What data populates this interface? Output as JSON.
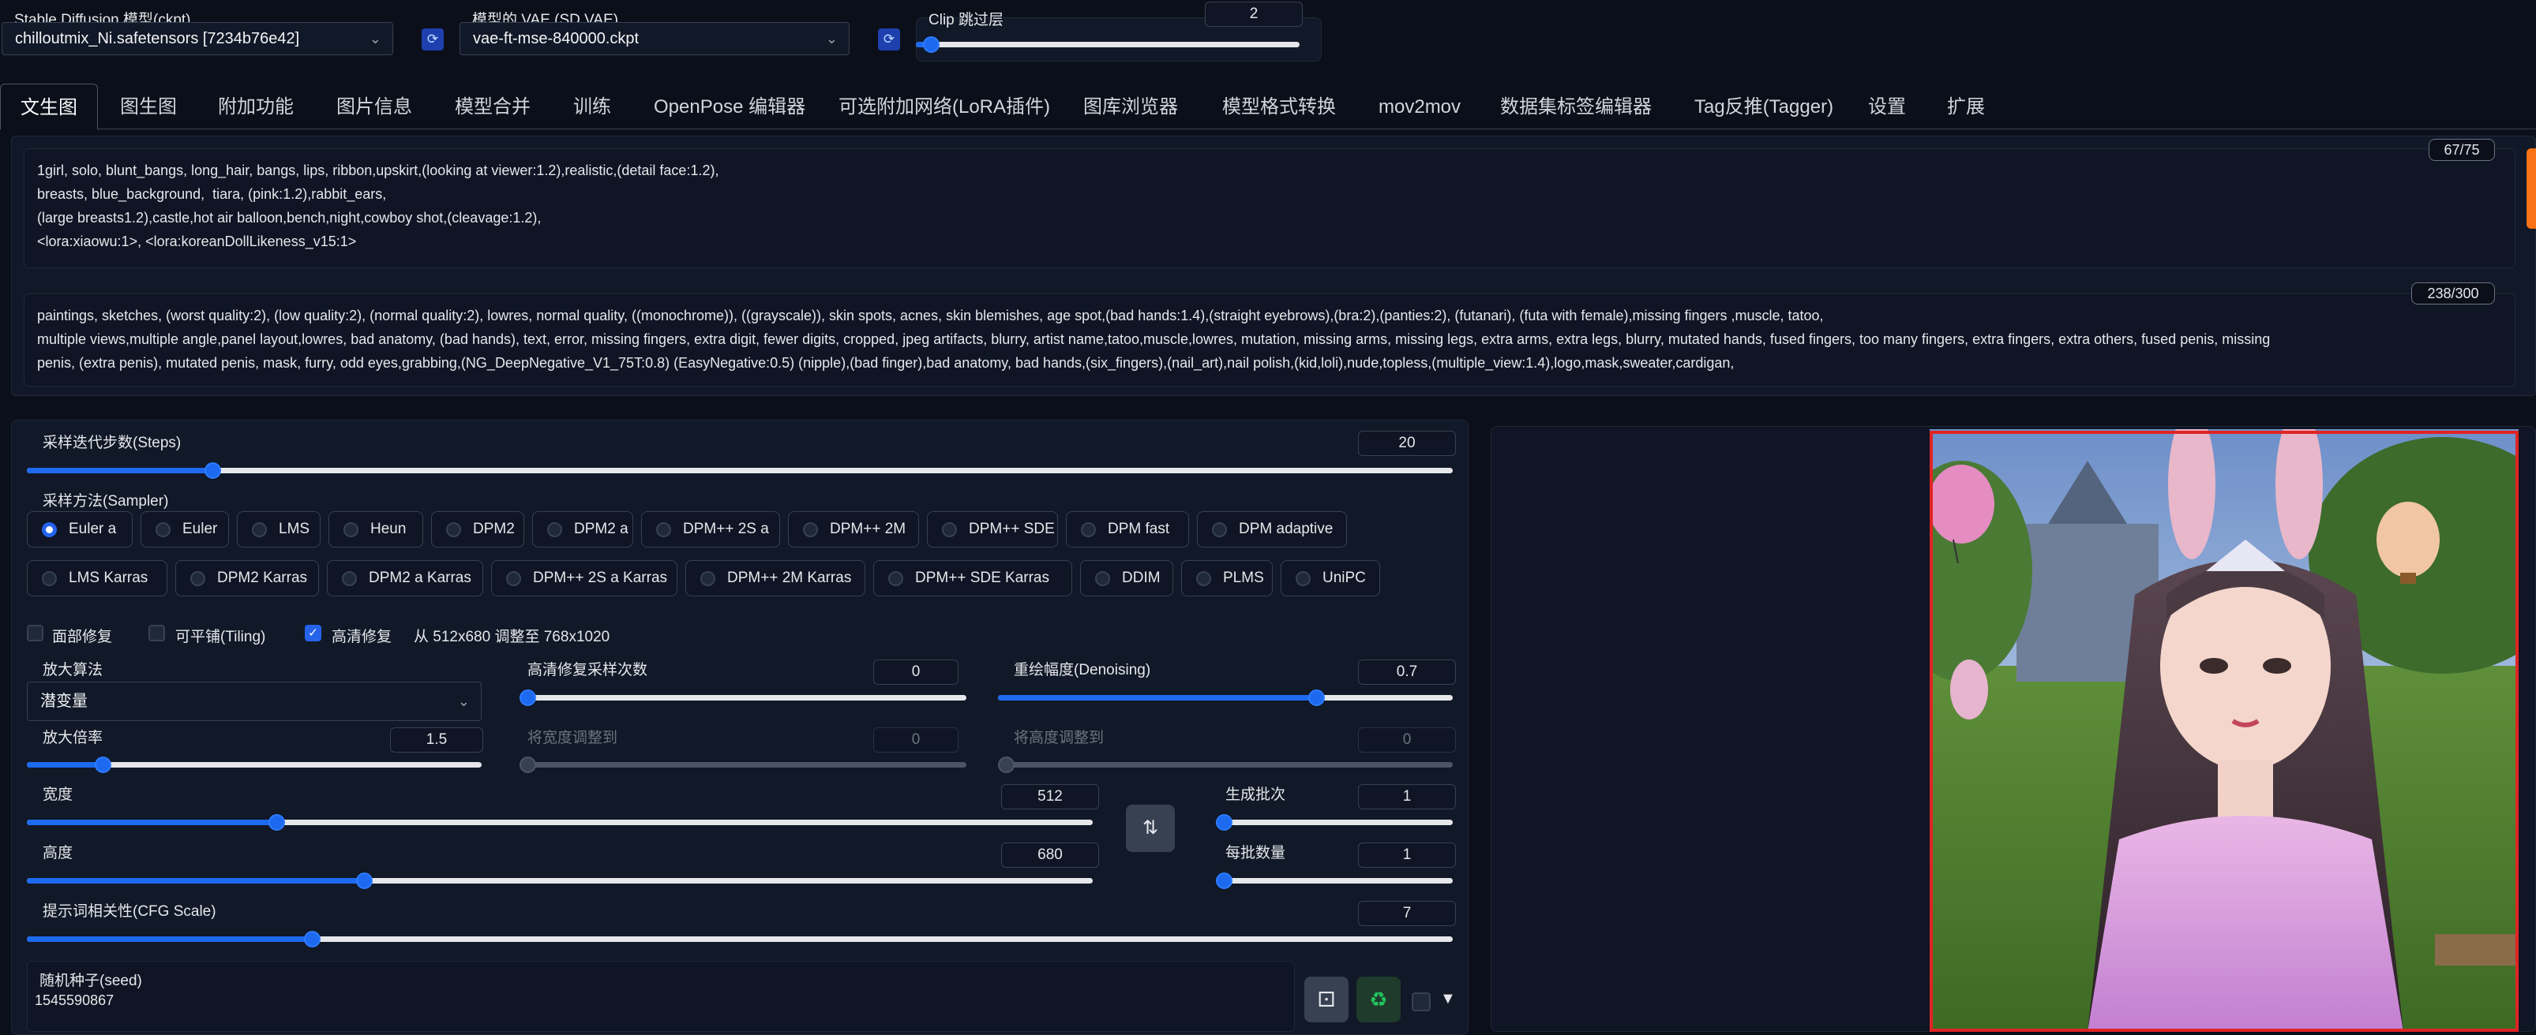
{
  "top": {
    "ckpt_label": "Stable Diffusion 模型(ckpt)",
    "ckpt_value": "chilloutmix_Ni.safetensors [7234b76e42]",
    "vae_label": "模型的 VAE (SD VAE)",
    "vae_value": "vae-ft-mse-840000.ckpt",
    "clip_label": "Clip 跳过层",
    "clip_value": "2",
    "clip_fraction": 0.04,
    "refresh_icon": "refresh-icon"
  },
  "tabs": [
    "文生图",
    "图生图",
    "附加功能",
    "图片信息",
    "模型合并",
    "训练",
    "OpenPose 编辑器",
    "可选附加网络(LoRA插件)",
    "图库浏览器",
    "模型格式转换",
    "mov2mov",
    "数据集标签编辑器",
    "Tag反推(Tagger)",
    "设置",
    "扩展"
  ],
  "prompt": {
    "positive": "1girl, solo, blunt_bangs, long_hair, bangs, lips, ribbon,upskirt,(looking at viewer:1.2),realistic,(detail face:1.2),\nbreasts, blue_background,  tiara, (pink:1.2),rabbit_ears,\n(large breasts1.2),castle,hot air balloon,bench,night,cowboy shot,(cleavage:1.2),\n<lora:xiaowu:1>, <lora:koreanDollLikeness_v15:1>",
    "positive_counter": "67/75",
    "negative": "paintings, sketches, (worst quality:2), (low quality:2), (normal quality:2), lowres, normal quality, ((monochrome)), ((grayscale)), skin spots, acnes, skin blemishes, age spot,(bad hands:1.4),(straight eyebrows),(bra:2),(panties:2), (futanari), (futa with female),missing fingers ,muscle, tatoo,\nmultiple views,multiple angle,panel layout,lowres, bad anatomy, (bad hands), text, error, missing fingers, extra digit, fewer digits, cropped, jpeg artifacts, blurry, artist name,tatoo,muscle,lowres, mutation, missing arms, missing legs, extra arms, extra legs, blurry, mutated hands, fused fingers, too many fingers, extra fingers, extra others, fused penis, missing\npenis, (extra penis), mutated penis, mask, furry, odd eyes,grabbing,(NG_DeepNegative_V1_75T:0.8) (EasyNegative:0.5) (nipple),(bad finger),bad anatomy, bad hands,(six_fingers),(nail_art),nail polish,(kid,loli),nude,topless,(multiple_view:1.4),logo,mask,sweater,cardigan,",
    "negative_counter": "238/300"
  },
  "steps": {
    "label": "采样迭代步数(Steps)",
    "value": "20",
    "fraction": 0.13
  },
  "sampler": {
    "label": "采样方法(Sampler)",
    "selected": "Euler a",
    "row1": [
      "Euler a",
      "Euler",
      "LMS",
      "Heun",
      "DPM2",
      "DPM2 a",
      "DPM++ 2S a",
      "DPM++ 2M",
      "DPM++ SDE",
      "DPM fast",
      "DPM adaptive"
    ],
    "row2": [
      "LMS Karras",
      "DPM2 Karras",
      "DPM2 a Karras",
      "DPM++ 2S a Karras",
      "DPM++ 2M Karras",
      "DPM++ SDE Karras",
      "DDIM",
      "PLMS",
      "UniPC"
    ]
  },
  "options": {
    "face_restore": "面部修复",
    "tiling": "可平铺(Tiling)",
    "hires": "高清修复",
    "hires_info": "从 512x680 调整至 768x1020"
  },
  "hires": {
    "upscaler_label": "放大算法",
    "upscaler_value": "潜变量",
    "hires_steps_label": "高清修复采样次数",
    "hires_steps_value": "0",
    "hires_steps_fraction": 0.0,
    "denoise_label": "重绘幅度(Denoising)",
    "denoise_value": "0.7",
    "denoise_fraction": 0.7,
    "scale_label": "放大倍率",
    "scale_value": "1.5",
    "scale_fraction": 0.167,
    "resize_w_label": "将宽度调整到",
    "resize_w_value": "0",
    "resize_h_label": "将高度调整到",
    "resize_h_value": "0"
  },
  "size": {
    "width_label": "宽度",
    "width_value": "512",
    "width_fraction": 0.234,
    "height_label": "高度",
    "height_value": "680",
    "height_fraction": 0.316,
    "swap_icon": "swap-icon",
    "batch_count_label": "生成批次",
    "batch_count_value": "1",
    "batch_size_label": "每批数量",
    "batch_size_value": "1"
  },
  "cfg": {
    "label": "提示词相关性(CFG Scale)",
    "value": "7",
    "fraction": 0.2
  },
  "seed": {
    "label": "随机种子(seed)",
    "value": "1545590867",
    "dice_icon": "dice-icon",
    "recycle_icon": "recycle-icon",
    "expand_icon": "triangle-down-icon"
  },
  "colors": {
    "accent": "#1d6af0",
    "bg": "#0b0f19",
    "panel": "#111827",
    "selection": "#e02424"
  }
}
